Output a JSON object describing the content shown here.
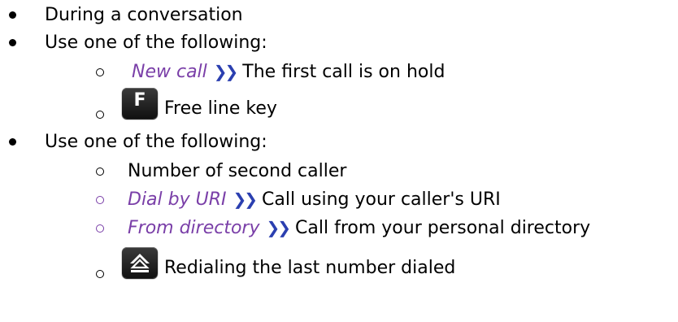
{
  "items": [
    {
      "text": "During a conversation"
    },
    {
      "text": "Use one of the following:"
    },
    {
      "menu": "New call",
      "text": "The first call is on hold"
    },
    {
      "key_glyph": "F",
      "key_icon": "free-line-key-icon",
      "text": "Free line key"
    },
    {
      "text": "Use one of the following:"
    },
    {
      "text": "Number of second caller"
    },
    {
      "menu": "Dial by URI",
      "text": "Call using your caller's URI"
    },
    {
      "menu": "From directory",
      "text": "Call from your personal directory"
    },
    {
      "key_icon": "redial-key-icon",
      "text": "Redialing the last number dialed"
    }
  ],
  "arrow_glyph": "❯❯",
  "colors": {
    "menu_item": "#7a3fa8",
    "arrow": "#2b3fb0",
    "key": "#1a1a1a"
  }
}
